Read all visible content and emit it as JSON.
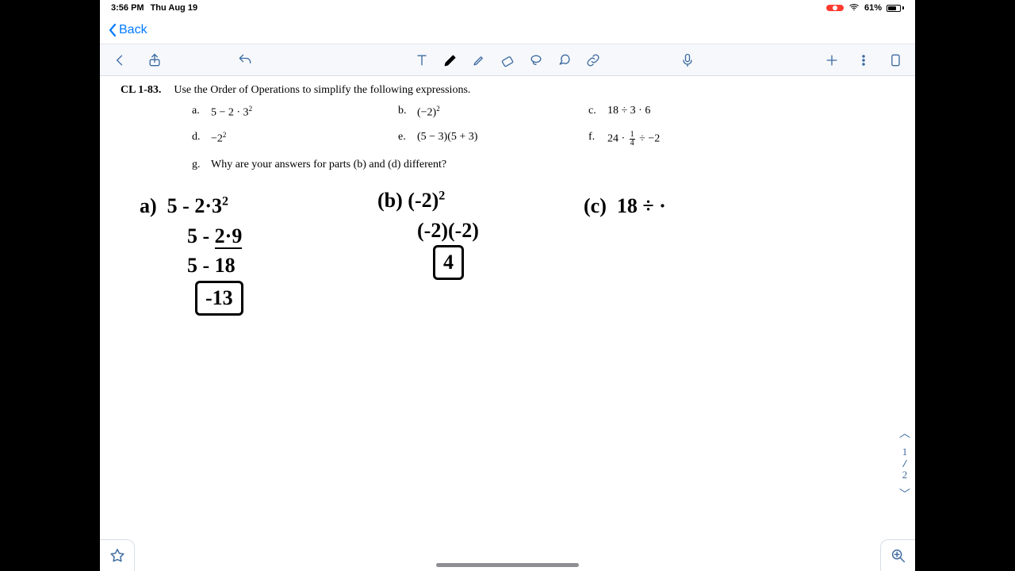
{
  "status": {
    "time": "3:56 PM",
    "date": "Thu Aug 19",
    "battery": "61%"
  },
  "nav": {
    "back_label": "Back"
  },
  "problem": {
    "id": "CL 1-83.",
    "prompt": "Use the Order of Operations to simplify the following expressions.",
    "items": {
      "a_label": "a.",
      "a_expr": "5 − 2 · 3",
      "b_label": "b.",
      "b_expr": "(−2)",
      "c_label": "c.",
      "c_expr": "18 ÷ 3 · 6",
      "d_label": "d.",
      "d_expr": "−2",
      "e_label": "e.",
      "e_expr": "(5 − 3)(5 + 3)",
      "f_label": "f.",
      "f_prefix": "24 · ",
      "f_num": "1",
      "f_den": "4",
      "f_suffix": " ÷ −2",
      "g_label": "g.",
      "g_text": "Why are your answers for parts (b) and (d) different?"
    },
    "exp2": "2"
  },
  "handwriting": {
    "a": {
      "label": "a)",
      "l1": "5 - 2·3",
      "l2a": "5 - ",
      "l2b": "2·9",
      "l3": "5 - 18",
      "ans": "-13"
    },
    "b": {
      "label": "(b)",
      "l1": "(-2)",
      "l2": "(-2)(-2)",
      "ans": "4"
    },
    "c": {
      "label": "(c)",
      "l1": "18 ÷ ·"
    }
  },
  "pagenav": {
    "current": "1",
    "total": "2"
  }
}
